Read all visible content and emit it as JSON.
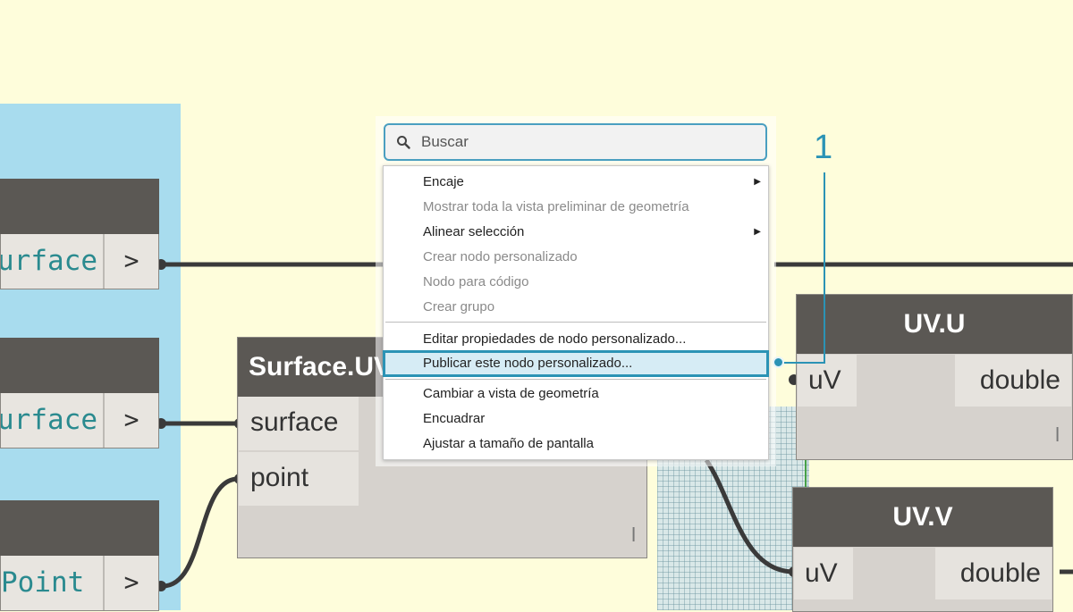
{
  "left_nodes": [
    {
      "port": "Surface",
      "arrow": ">"
    },
    {
      "port": "Surface",
      "arrow": ">"
    },
    {
      "port": "Point",
      "arrow": ">"
    }
  ],
  "surface_node": {
    "title": "Surface.UV",
    "inputs": [
      "surface",
      "point"
    ],
    "corner": "l"
  },
  "uv_u_node": {
    "title": "UV.U",
    "input": "uV",
    "output": "double",
    "corner": "l"
  },
  "uv_v_node": {
    "title": "UV.V",
    "input": "uV",
    "output": "double"
  },
  "search": {
    "placeholder": "Buscar"
  },
  "menu": {
    "items": [
      {
        "label": "Encaje",
        "disabled": false,
        "submenu": true
      },
      {
        "label": "Mostrar toda la vista preliminar de geometría",
        "disabled": true
      },
      {
        "label": "Alinear selección",
        "disabled": false,
        "submenu": true
      },
      {
        "label": "Crear nodo personalizado",
        "disabled": true
      },
      {
        "label": "Nodo para código",
        "disabled": true
      },
      {
        "label": "Crear grupo",
        "disabled": true
      },
      {
        "label": "Editar propiedades de nodo personalizado...",
        "disabled": false
      },
      {
        "label": "Publicar este nodo personalizado...",
        "disabled": false,
        "highlighted": true
      },
      {
        "label": "Cambiar a vista de geometría",
        "disabled": false
      },
      {
        "label": "Encuadrar",
        "disabled": false
      },
      {
        "label": "Ajustar a tamaño de pantalla",
        "disabled": false
      }
    ],
    "submenu_glyph": "▶"
  },
  "callout": {
    "number": "1"
  },
  "colors": {
    "canvas": "#fefddb",
    "group": "#a8dcee",
    "node_header": "#5b5854",
    "accent": "#2b93b5",
    "port_text": "#2a8a8f"
  }
}
